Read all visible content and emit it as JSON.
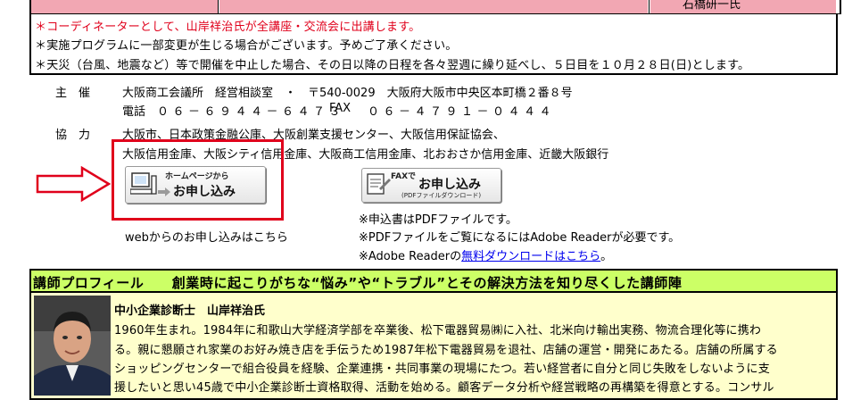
{
  "top_strip": {
    "cut_text": "石橋研一氏"
  },
  "notes": [
    "＊コーディネーターとして、山岸祥治氏が全講座・交流会に出講します。",
    "＊実施プログラムに一部変更が生じる場合がございます。予めご了承ください。",
    "＊天災（台風、地震など）等で開催を中止した場合、その日以降の日程を各々翌週に繰り延べし、５日目を１０月２８日(日)とします。"
  ],
  "organizer": {
    "label": "主　催",
    "line1": "大阪商工会議所　経営相談室　・　〒540-0029　大阪府大阪市中央区本町橋２番８号",
    "phone_label": "電話",
    "phone": "０６－６９４４－６４７３",
    "fax_label": "FAX",
    "fax": "０６－４７９１－０４４４"
  },
  "cooperation": {
    "label": "協　力",
    "line1": "大阪市、日本政策金融公庫、大阪創業支援センター、大阪信用保証協会、",
    "line2": "大阪信用金庫、大阪シティ信用金庫、大阪商工信用金庫、北おおさか信用金庫、近畿大阪銀行"
  },
  "web_button": {
    "small": "ホームページから",
    "big": "お申し込み"
  },
  "web_caption": "webからのお申し込みはこちら",
  "fax_button": {
    "small": "FAXで",
    "big": "お申し込み",
    "tiny": "(PDFファイルダウンロード)"
  },
  "pdf_notes": {
    "line1": "※申込書はPDFファイルです。",
    "line2": "※PDFファイルをご覧になるにはAdobe Readerが必要です。",
    "line3_prefix": "※Adobe Readerの",
    "line3_link": "無料ダウンロードはこちら",
    "line3_suffix": "。"
  },
  "profile": {
    "header": "講師プロフィール　　創業時に起こりがちな“悩み”や“トラブル”とその解決方法を知り尽くした講師陣",
    "name": "中小企業診断士　山岸祥治氏",
    "lines": [
      "1960年生まれ。1984年に和歌山大学経済学部を卒業後、松下電器貿易㈱に入社、北米向け輸出実務、物流合理化等に携わ",
      "る。親に懇願され家業のお好み焼き店を手伝うため1987年松下電器貿易を退社、店舗の運営・開発にあたる。店舗の所属する",
      "ショッピングセンターで組合役員を経験、企業連携・共同事業の現場にたつ。若い経営者に自分と同じ失敗をしないように支",
      "援したいと思い45歳で中小企業診断士資格取得、活動を始める。顧客データ分析や経営戦略の再構築を得意とする。コンサル"
    ]
  },
  "colors": {
    "accent_red": "#e0001b",
    "header_green": "#ccff66",
    "profile_bg": "#ffffcc",
    "top_pink": "#f2a7b3"
  }
}
